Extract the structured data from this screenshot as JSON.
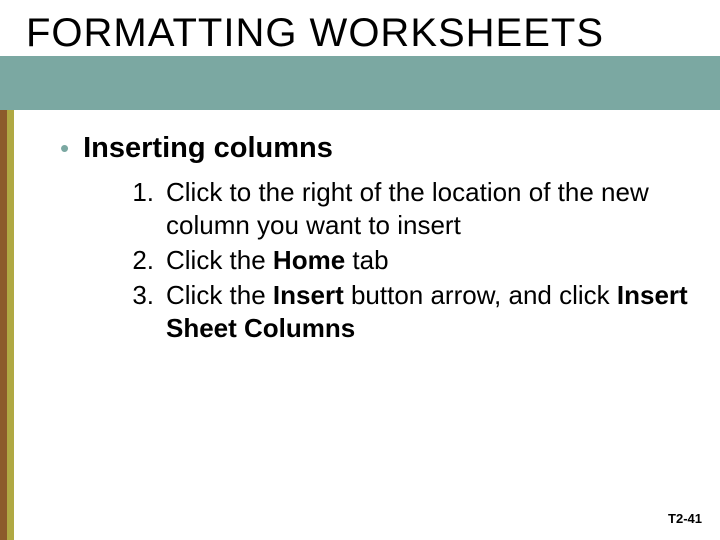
{
  "title": "FORMATTING WORKSHEETS",
  "bullet": {
    "dot": "•",
    "text": "Inserting columns"
  },
  "steps": [
    {
      "marker": "1.",
      "pre": "Click to the right of the location of the new column you want to insert",
      "bold1": "",
      "mid": "",
      "bold2": "",
      "post": ""
    },
    {
      "marker": "2.",
      "pre": "Click the ",
      "bold1": "Home",
      "mid": " tab",
      "bold2": "",
      "post": ""
    },
    {
      "marker": "3.",
      "pre": "Click the ",
      "bold1": "Insert",
      "mid": " button arrow, and click ",
      "bold2": "Insert Sheet Columns",
      "post": ""
    }
  ],
  "slide_number": "T2-41",
  "colors": {
    "teal": "#7ba8a2",
    "olive": "#b0a943",
    "brown": "#8c5b2b"
  }
}
